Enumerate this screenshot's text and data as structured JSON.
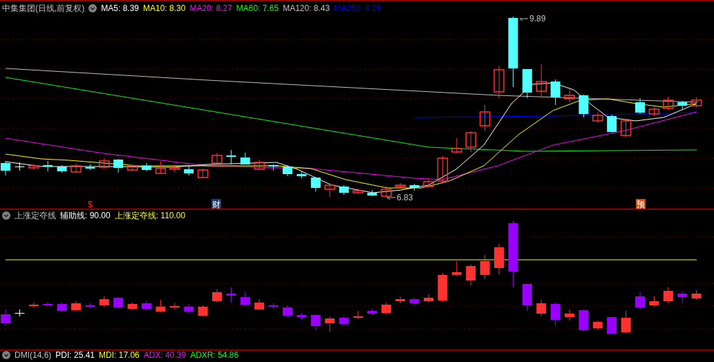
{
  "main_chart": {
    "title": "中集集团(日线,前复权)",
    "indicators": [
      {
        "label": "MA5: 8.39",
        "color": "#ffffff"
      },
      {
        "label": "MA10: 8.30",
        "color": "#ffff00"
      },
      {
        "label": "MA20: 8.27",
        "color": "#ff00ff"
      },
      {
        "label": "MA60: 7.65",
        "color": "#00ff00"
      },
      {
        "label": "MA120: 8.43",
        "color": "#c0c0c0"
      },
      {
        "label": "MA250: 8.29",
        "color": "#0000ff"
      }
    ],
    "annotations": [
      {
        "kind": "high",
        "text": "9.89"
      },
      {
        "kind": "low",
        "text": "6.83"
      }
    ],
    "markers": [
      {
        "kind": "dividend",
        "text": "$"
      },
      {
        "kind": "finance",
        "text": "财"
      },
      {
        "kind": "forecast",
        "text": "预"
      }
    ]
  },
  "sub_chart": {
    "title": "上涨定夺线",
    "values": [
      {
        "label": "辅助线: 90.00",
        "color": "#ffffff"
      },
      {
        "label": "上涨定夺线: 110.00",
        "color": "#ffff00"
      }
    ]
  },
  "bottom_panel": {
    "title": "DMI(14,6)",
    "values": [
      {
        "label": "PDI: 25.41",
        "color": "#ffffff"
      },
      {
        "label": "MDI: 17.06",
        "color": "#ffff00"
      },
      {
        "label": "ADX: 40.39",
        "color": "#ff00ff"
      },
      {
        "label": "ADXR: 54.86",
        "color": "#00ff00"
      }
    ]
  }
}
